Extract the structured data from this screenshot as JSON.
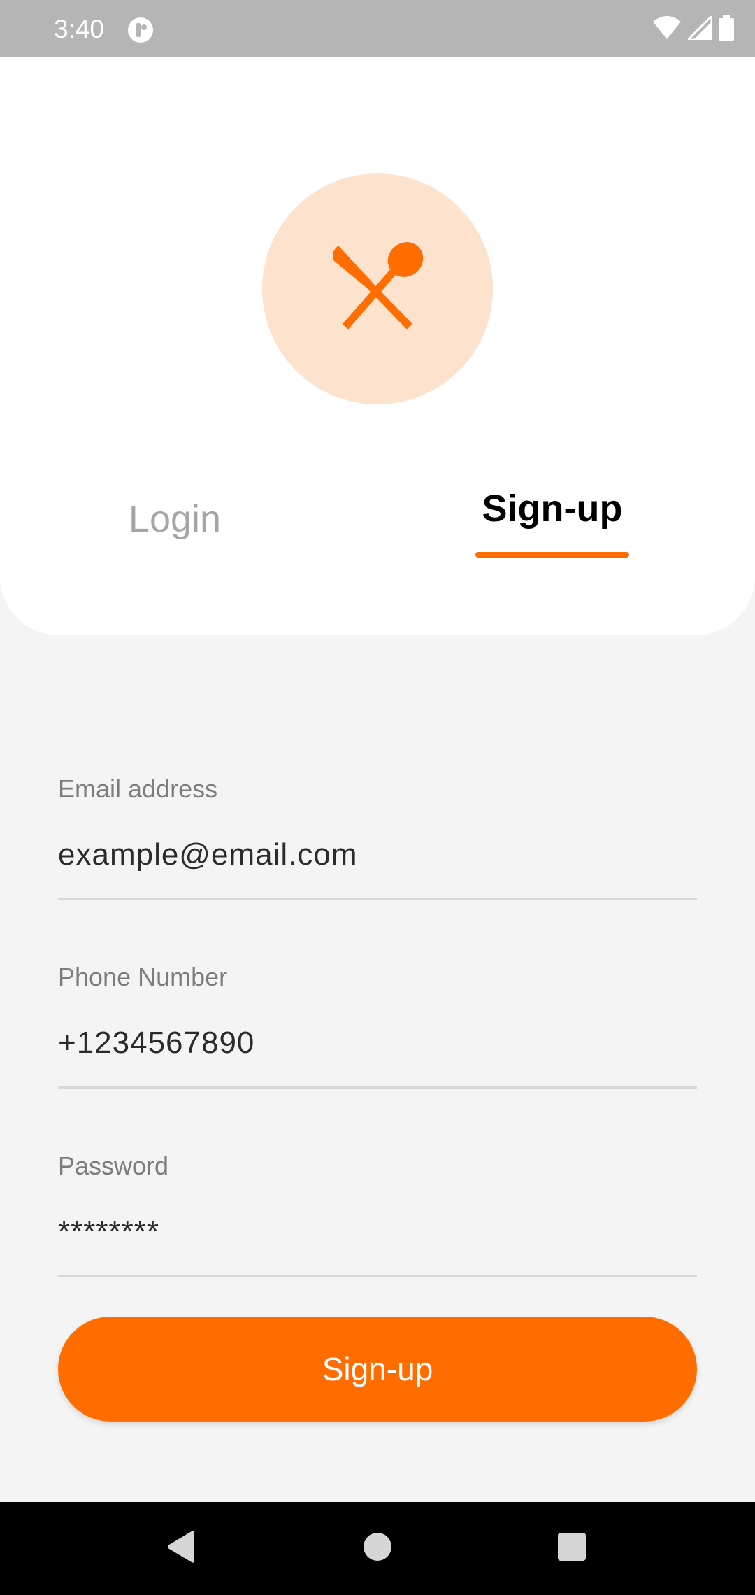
{
  "status_bar": {
    "time": "3:40",
    "icons": [
      "app-notification-icon",
      "wifi-icon",
      "signal-icon",
      "battery-icon"
    ]
  },
  "logo": {
    "icon": "fork-knife-spoon-icon",
    "circle_color": "#fde2cd",
    "icon_color": "#ff6d00"
  },
  "tabs": [
    {
      "label": "Login",
      "active": false
    },
    {
      "label": "Sign-up",
      "active": true
    }
  ],
  "form": {
    "email": {
      "label": "Email address",
      "value": "example@email.com"
    },
    "phone": {
      "label": "Phone Number",
      "value": "+1234567890"
    },
    "password": {
      "label": "Password",
      "value": "********"
    }
  },
  "submit_button": {
    "label": "Sign-up"
  },
  "nav_bar": {
    "icons": [
      "back-icon",
      "home-icon",
      "recents-icon"
    ]
  },
  "colors": {
    "accent": "#ff6d00",
    "background": "#f4f4f4",
    "status_bar": "#b5b5b5"
  }
}
